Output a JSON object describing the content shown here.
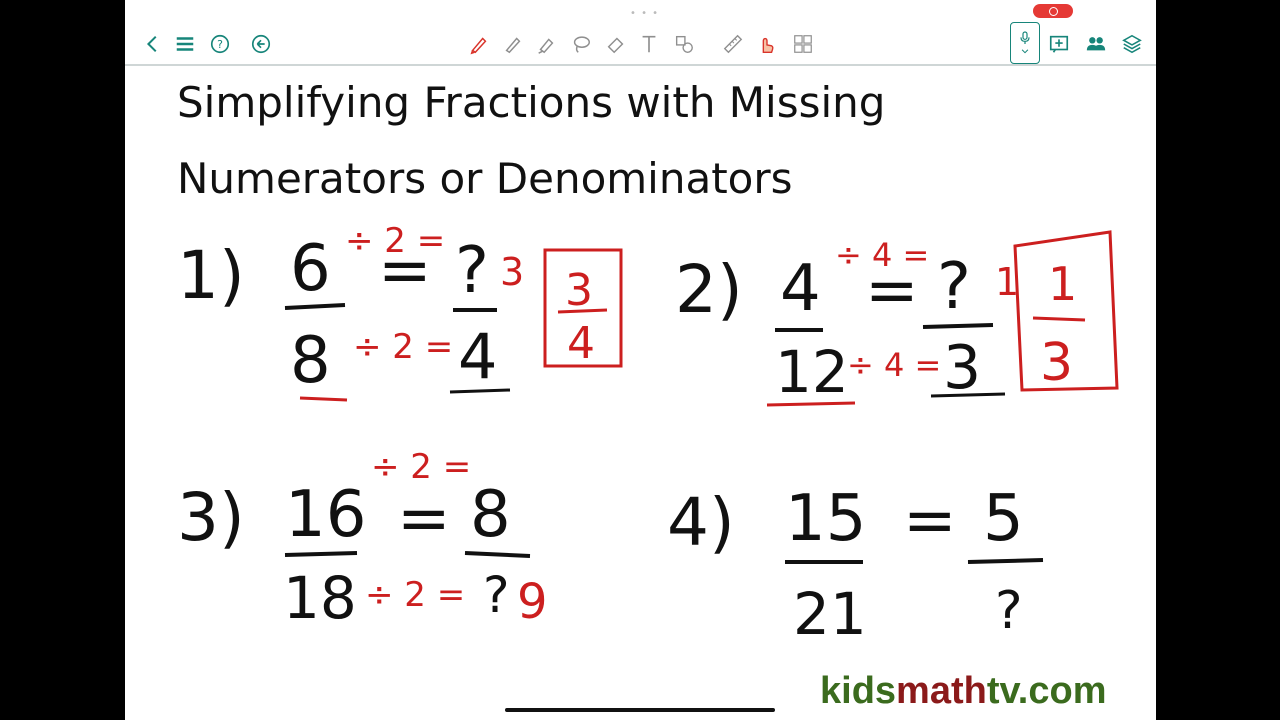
{
  "toolbar": {
    "left_icons": [
      "back-icon",
      "menu-icon",
      "help-icon",
      "undo-icon"
    ],
    "tool_icons": [
      "pen-icon",
      "pencil-icon",
      "highlighter-icon",
      "lasso-icon",
      "eraser-icon",
      "text-icon",
      "shapes-icon",
      "ruler-icon",
      "hand-icon",
      "grid-icon"
    ],
    "right_icons": [
      "microphone-icon",
      "add-page-icon",
      "people-icon",
      "layers-icon"
    ],
    "accent_color": "#17857a",
    "record_color": "#e53935"
  },
  "title": {
    "line1": "Simplifying Fractions with Missing",
    "line2": "Numerators or Denominators"
  },
  "problems": [
    {
      "label": "1)",
      "num1": "6",
      "den1": "8",
      "num2": "?",
      "den2": "4",
      "op_top": "÷ 2 =",
      "op_bottom": "÷ 2 =",
      "answer_num": "3",
      "answer_den": "4",
      "side_note": "3"
    },
    {
      "label": "2)",
      "num1": "4",
      "den1": "12",
      "num2": "?",
      "den2": "3",
      "op_top": "÷ 4 =",
      "op_bottom": "÷ 4 =",
      "answer_num": "1",
      "answer_den": "3",
      "side_note": "1"
    },
    {
      "label": "3)",
      "num1": "16",
      "den1": "18",
      "num2": "8",
      "den2": "?",
      "op_top": "÷ 2 =",
      "op_bottom": "÷ 2 =",
      "side_note": "9"
    },
    {
      "label": "4)",
      "num1": "15",
      "den1": "21",
      "num2": "5",
      "den2": "?"
    }
  ],
  "eq_sign": "=",
  "brand": {
    "kids": "kids",
    "math": "math",
    "tv": "tv.com"
  },
  "ink_colors": {
    "black": "#111111",
    "red": "#cc1f1f"
  }
}
